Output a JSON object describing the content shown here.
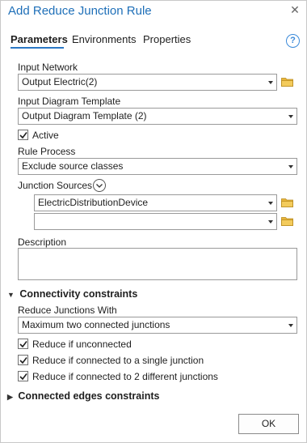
{
  "window": {
    "title": "Add Reduce Junction Rule"
  },
  "tabs": [
    {
      "label": "Parameters",
      "active": true
    },
    {
      "label": "Environments",
      "active": false
    },
    {
      "label": "Properties",
      "active": false
    }
  ],
  "form": {
    "input_network": {
      "label": "Input Network",
      "value": "Output Electric(2)"
    },
    "input_template": {
      "label": "Input Diagram Template",
      "value": "Output Diagram Template (2)"
    },
    "active": {
      "label": "Active",
      "checked": true
    },
    "rule_process": {
      "label": "Rule Process",
      "value": "Exclude source classes"
    },
    "junction_sources": {
      "label": "Junction Sources",
      "rows": [
        "ElectricDistributionDevice",
        ""
      ]
    },
    "description": {
      "label": "Description",
      "value": ""
    }
  },
  "connectivity": {
    "heading": "Connectivity constraints",
    "expanded": true,
    "reduce_with": {
      "label": "Reduce Junctions With",
      "value": "Maximum two connected junctions"
    },
    "options": [
      {
        "label": "Reduce if unconnected",
        "checked": true
      },
      {
        "label": "Reduce if connected to a single junction",
        "checked": true
      },
      {
        "label": "Reduce if connected to 2 different junctions",
        "checked": true
      }
    ]
  },
  "connected_edges": {
    "heading": "Connected edges constraints",
    "expanded": false
  },
  "footer": {
    "ok_label": "OK"
  },
  "colors": {
    "accent": "#1e6fb8",
    "tab_underline": "#2b78c5",
    "folder": "#e8b53a"
  }
}
